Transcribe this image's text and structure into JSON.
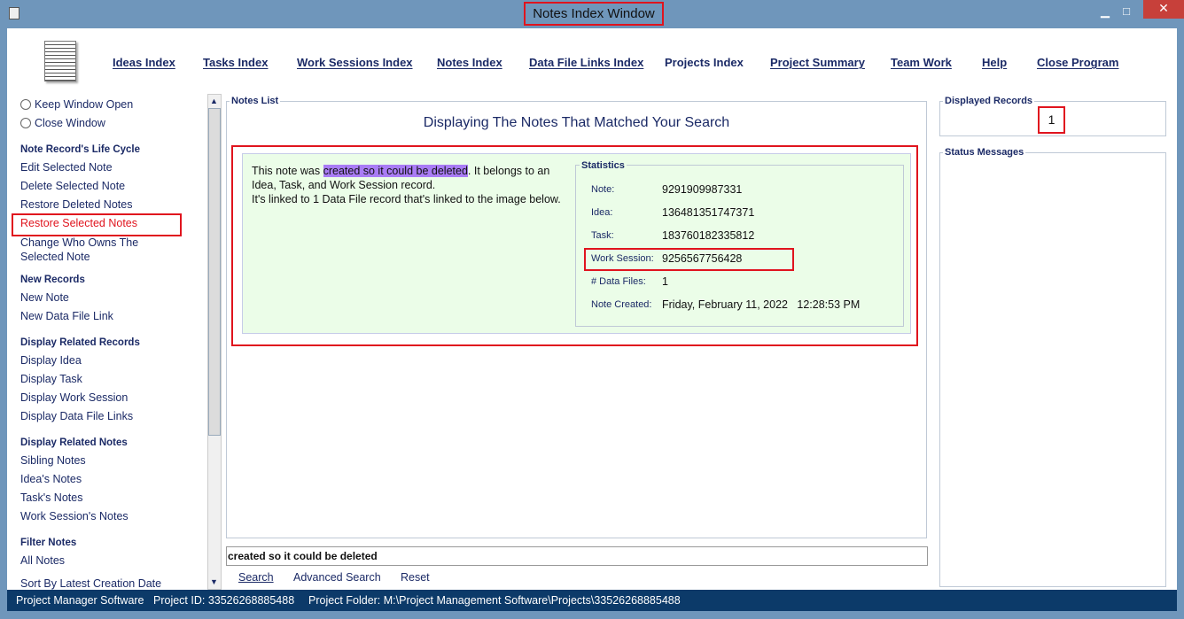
{
  "window": {
    "title": "Notes Index Window",
    "minimize": "▁",
    "maximize": "□",
    "close": "✕"
  },
  "nav": [
    "Ideas Index",
    "Tasks Index",
    "Work Sessions Index",
    "Notes Index",
    "Data File Links Index",
    "Projects Index",
    "Project Summary",
    "Team Work",
    "Help",
    "Close Program"
  ],
  "sidebar": {
    "keep_open": "Keep Window Open",
    "close_window": "Close Window",
    "life_cycle_heading": "Note Record's Life Cycle",
    "life_cycle": [
      "Edit Selected Note",
      "Delete Selected Note",
      "Restore Deleted Notes",
      "Restore Selected Notes",
      "Change Who Owns The",
      "Selected Note"
    ],
    "new_heading": "New Records",
    "new": [
      "New Note",
      "New Data File Link"
    ],
    "related_heading": "Display Related Records",
    "related": [
      "Display Idea",
      "Display Task",
      "Display Work Session",
      "Display Data File Links"
    ],
    "notes_heading": "Display Related Notes",
    "notes": [
      "Sibling Notes",
      "Idea's Notes",
      "Task's Notes",
      "Work Session's Notes"
    ],
    "filter_heading": "Filter Notes",
    "filter": [
      "All Notes",
      "Sort By Latest Creation Date"
    ]
  },
  "notes_list": {
    "title": "Notes List",
    "heading": "Displaying The Notes That Matched Your Search",
    "note": {
      "pre": "This note was ",
      "highlight": "created so it could be deleted",
      "post": ". It belongs to an",
      "line2": "Idea, Task, and Work Session record.",
      "line3": "It's linked to 1 Data File record that's linked to the image below."
    },
    "highlight_color": "#a97cf5",
    "statistics": {
      "title": "Statistics",
      "rows": [
        {
          "label": "Note:",
          "value": "9291909987331"
        },
        {
          "label": "Idea:",
          "value": "136481351747371"
        },
        {
          "label": "Task:",
          "value": "183760182335812"
        },
        {
          "label": "Work Session:",
          "value": "9256567756428"
        },
        {
          "label": "# Data Files:",
          "value": "1"
        },
        {
          "label": "Note Created:",
          "value": "Friday, February 11, 2022   12:28:53 PM"
        }
      ]
    }
  },
  "search": {
    "value": "created so it could be deleted",
    "search": "Search",
    "advanced": "Advanced Search",
    "reset": "Reset"
  },
  "displayed_records": {
    "title": "Displayed Records",
    "value": "1"
  },
  "status_messages": {
    "title": "Status Messages"
  },
  "statusbar": {
    "app": "Project Manager Software",
    "project_id": "Project ID:  33526268885488",
    "folder": "Project Folder: M:\\Project Management Software\\Projects\\33526268885488"
  }
}
